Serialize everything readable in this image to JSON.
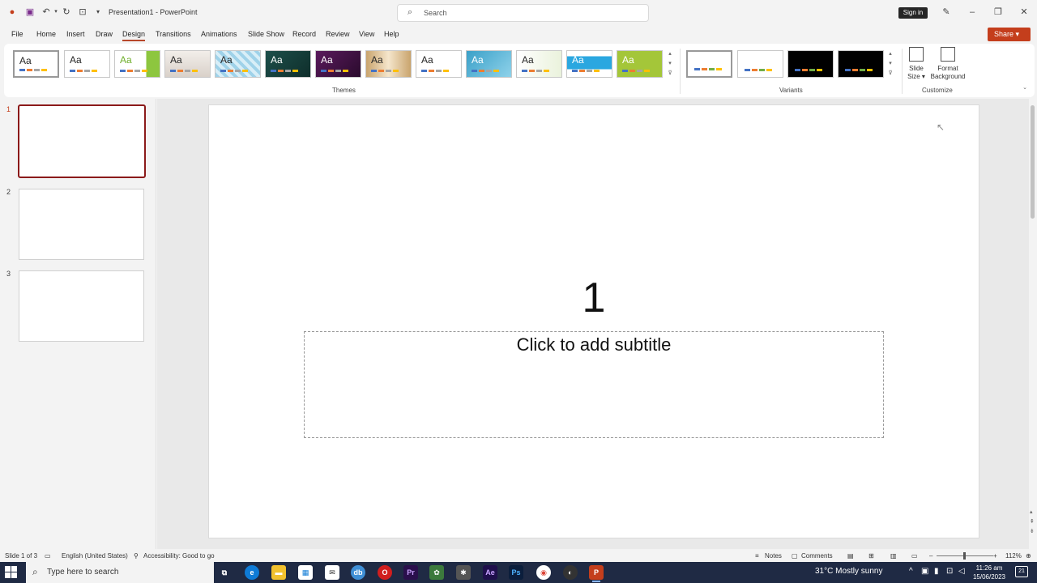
{
  "app": {
    "title": "Presentation1  -  PowerPoint",
    "search_placeholder": "Search",
    "sign_in": "Sign in",
    "share": "Share"
  },
  "tabs": [
    "File",
    "Home",
    "Insert",
    "Draw",
    "Design",
    "Transitions",
    "Animations",
    "Slide Show",
    "Record",
    "Review",
    "View",
    "Help"
  ],
  "active_tab": "Design",
  "ribbon": {
    "themes_label": "Themes",
    "variants_label": "Variants",
    "customize_label": "Customize",
    "theme_sample": "Aa",
    "slide_size": [
      "Slide",
      "Size ▾"
    ],
    "format_background": [
      "Format",
      "Background"
    ]
  },
  "thumbnails": [
    {
      "num": "1"
    },
    {
      "num": "2"
    },
    {
      "num": "3"
    }
  ],
  "slide": {
    "title": "1",
    "subtitle_placeholder": "Click to add subtitle"
  },
  "status": {
    "slide_info": "Slide 1 of 3",
    "language": "English (United States)",
    "accessibility": "Accessibility: Good to go",
    "notes": "Notes",
    "comments": "Comments",
    "zoom": "112%"
  },
  "taskbar": {
    "search_placeholder": "Type here to search",
    "weather": "31°C  Mostly sunny",
    "time": "11:26 am",
    "date": "15/06/2023",
    "notif_count": "21"
  },
  "colors": {
    "accent": "#b7472a",
    "share": "#c43e1c",
    "selected_thumb": "#8b1a1a",
    "taskbar": "#1f2a44"
  }
}
